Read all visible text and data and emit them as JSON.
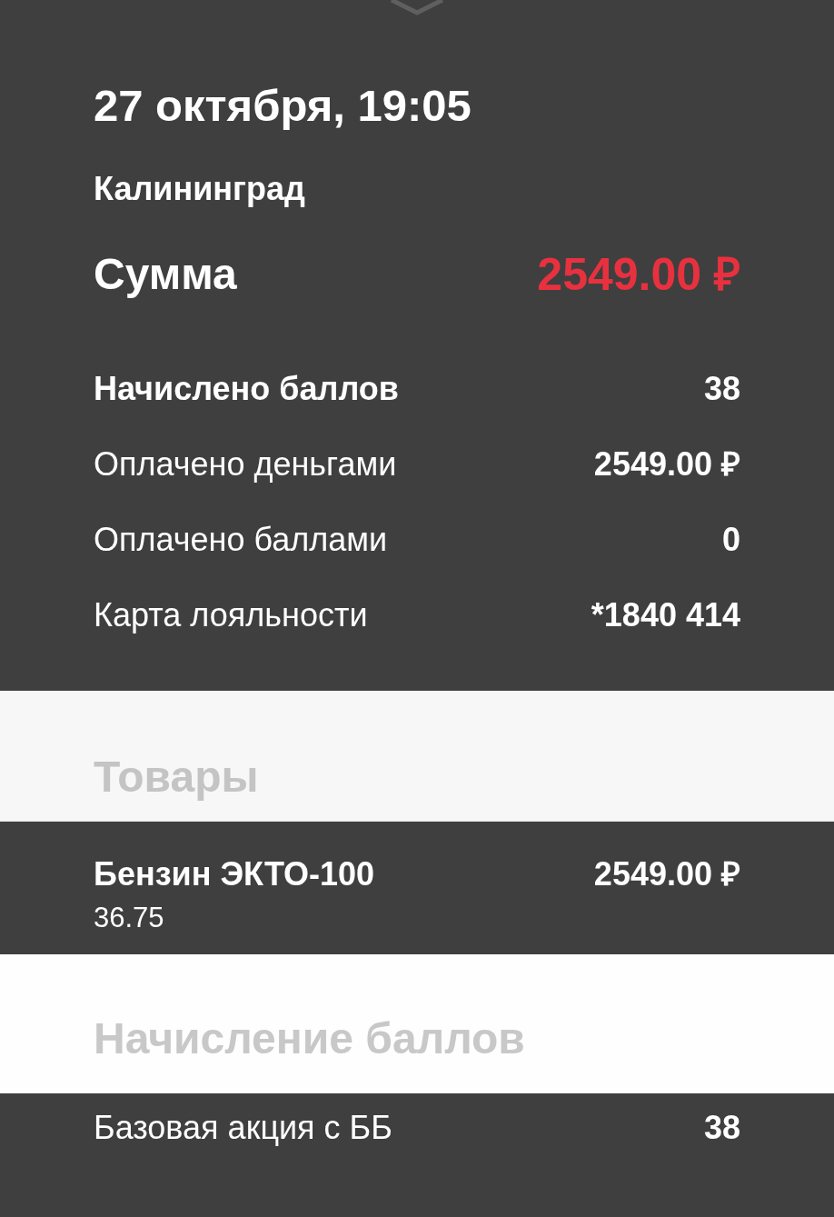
{
  "header": {
    "date_time": "27 октября, 19:05",
    "city": "Калининград",
    "total_label": "Сумма",
    "total_value": "2549.00 ₽"
  },
  "details": [
    {
      "label": "Начислено баллов",
      "value": "38",
      "kind": "strong"
    },
    {
      "label": "Оплачено деньгами",
      "value": "2549.00 ₽",
      "kind": "normal"
    },
    {
      "label": "Оплачено баллами",
      "value": "0",
      "kind": "normal"
    },
    {
      "label": "Карта лояльности",
      "value": "*1840 414",
      "kind": "normal"
    }
  ],
  "goods": {
    "title": "Товары",
    "items": [
      {
        "name": "Бензин ЭКТО-100",
        "quantity": "36.75",
        "price": "2549.00 ₽"
      }
    ]
  },
  "points_accrual": {
    "title": "Начисление баллов",
    "items": [
      {
        "name": "Базовая акция с ББ",
        "points": "38"
      }
    ]
  }
}
